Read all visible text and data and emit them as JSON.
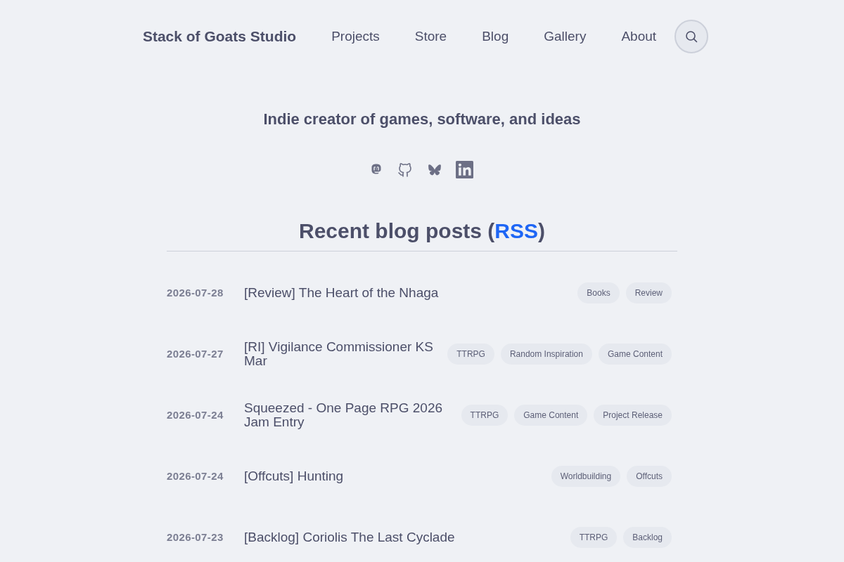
{
  "header": {
    "site_title": "Stack of Goats Studio",
    "nav": [
      "Projects",
      "Store",
      "Blog",
      "Gallery",
      "About"
    ]
  },
  "tagline": "Indie creator of games, software, and ideas",
  "section": {
    "heading_start": "Recent blog posts (",
    "link": "RSS",
    "heading_end": ")"
  },
  "posts": [
    {
      "date": "2026-07-28",
      "title": "[Review] The Heart of the Nhaga",
      "tags": [
        "Books",
        "Review"
      ]
    },
    {
      "date": "2026-07-27",
      "title": "[RI] Vigilance Commissioner KS Mar",
      "tags": [
        "TTRPG",
        "Random Inspiration",
        "Game Content"
      ]
    },
    {
      "date": "2026-07-24",
      "title": "Squeezed - One Page RPG 2026 Jam Entry",
      "tags": [
        "TTRPG",
        "Game Content",
        "Project Release"
      ]
    },
    {
      "date": "2026-07-24",
      "title": "[Offcuts] Hunting",
      "tags": [
        "Worldbuilding",
        "Offcuts"
      ]
    },
    {
      "date": "2026-07-23",
      "title": "[Backlog] Coriolis The Last Cyclade",
      "tags": [
        "TTRPG",
        "Backlog"
      ]
    }
  ]
}
